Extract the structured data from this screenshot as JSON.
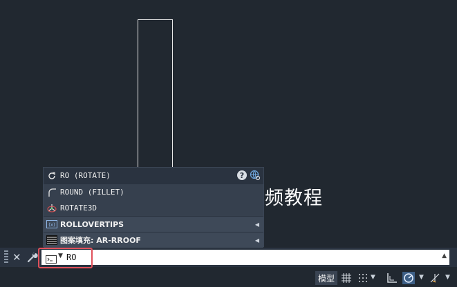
{
  "canvas": {
    "overlay_text": "频教程"
  },
  "autocomplete": {
    "items": [
      {
        "label": "RO (ROTATE)",
        "icon": "rotate-icon"
      },
      {
        "label": "ROUND (FILLET)",
        "icon": "fillet-icon"
      },
      {
        "label": "ROTATE3D",
        "icon": "rotate3d-icon"
      },
      {
        "label": "ROLLOVERTIPS",
        "icon": "sysvar-icon"
      },
      {
        "label": "图案填充: AR-RROOF",
        "icon": "hatch-pattern-icon"
      }
    ],
    "help_symbol": "?"
  },
  "command_line": {
    "value": "RO",
    "close_symbol": "✕"
  },
  "status_bar": {
    "model_label": "模型"
  },
  "colors": {
    "background": "#212830",
    "popup": "#2a3340",
    "highlight": "#e0505a"
  }
}
